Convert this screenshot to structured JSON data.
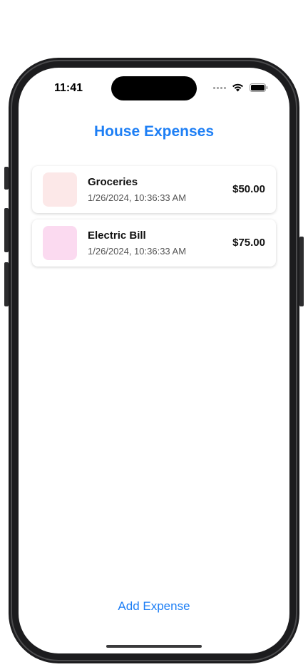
{
  "status_bar": {
    "time": "11:41",
    "icons": [
      "cellular-signal-icon",
      "wifi-icon",
      "battery-icon"
    ]
  },
  "header": {
    "title": "House Expenses"
  },
  "expenses": [
    {
      "name": "Groceries",
      "date": "1/26/2024, 10:36:33 AM",
      "amount": "$50.00",
      "thumb_color": "#fce8e8"
    },
    {
      "name": "Electric Bill",
      "date": "1/26/2024, 10:36:33 AM",
      "amount": "$75.00",
      "thumb_color": "#fbdaf0"
    }
  ],
  "footer": {
    "add_button_label": "Add Expense"
  },
  "colors": {
    "accent": "#1e7ff5"
  }
}
